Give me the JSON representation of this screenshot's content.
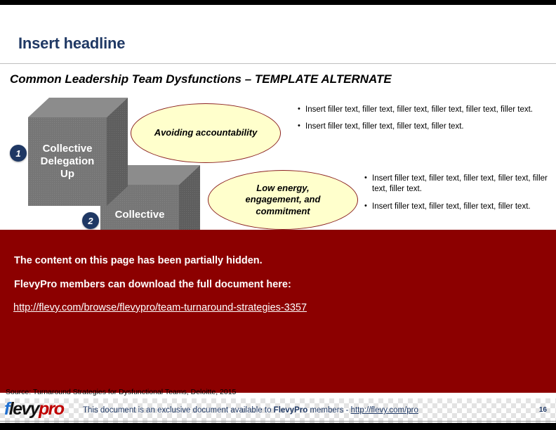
{
  "slide": {
    "headline": "Insert headline",
    "subtitle": "Common Leadership Team Dysfunctions – TEMPLATE ALTERNATE"
  },
  "diagram": {
    "items": [
      {
        "number": "1",
        "box_label": "Collective\nDelegation\nUp",
        "box_label_lines": [
          "Collective",
          "Delegation",
          "Up"
        ],
        "callout": "Avoiding accountability",
        "bullets": [
          "Insert filler text, filler text, filler text, filler text, filler text, filler text.",
          "Insert filler text, filler text, filler text, filler text."
        ]
      },
      {
        "number": "2",
        "box_label": "Collective",
        "box_label_lines": [
          "Collective"
        ],
        "callout": "Low energy, engagement, and commitment",
        "callout_lines": [
          "Low energy,",
          "engagement, and",
          "commitment"
        ],
        "bullets": [
          "Insert filler text, filler text, filler text, filler text, filler text, filler text.",
          "Insert filler text, filler text, filler text, filler text."
        ]
      }
    ]
  },
  "overlay": {
    "line1": "The content on this page has been partially hidden.",
    "line2": "FlevyPro members can download the full document here:",
    "link": "http://flevy.com/browse/flevypro/team-turnaround-strategies-3357",
    "color": "#8C0000"
  },
  "source": "Source: Turnaround Strategies for Dysfunctional Teams, Deloitte, 2015",
  "footer": {
    "logo_f": "f",
    "logo_levy": "levy",
    "logo_pro": "pro",
    "text_before": "This document is an exclusive document available to ",
    "brand": "FlevyPro",
    "text_after": " members - ",
    "link": "http://flevy.com/pro",
    "page_number": "16"
  },
  "colors": {
    "headline": "#1F3864",
    "badge": "#1F3864",
    "callout_fill": "#FFFFCC",
    "callout_border": "#8B2222",
    "banner": "#8C0000",
    "box_front": "#767676",
    "box_top": "#8C8C8C",
    "box_side": "#5E5E5E"
  }
}
